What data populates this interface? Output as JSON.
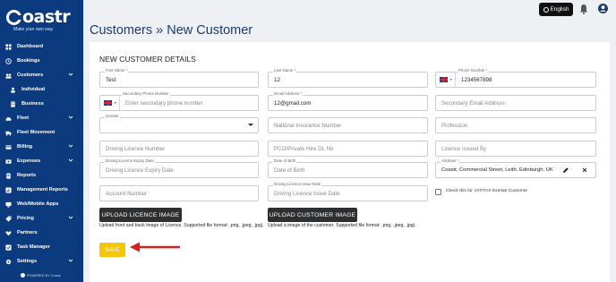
{
  "brand": {
    "name": "Coastr",
    "tagline": "Make your own way"
  },
  "sidebar": {
    "items": [
      {
        "label": "Dashboard",
        "icon": "dashboard-icon"
      },
      {
        "label": "Bookings",
        "icon": "bookings-icon"
      },
      {
        "label": "Customers",
        "icon": "users-icon",
        "expandable": true
      },
      {
        "label": "Individual",
        "icon": "person-icon",
        "sub": true
      },
      {
        "label": "Business",
        "icon": "building-icon",
        "sub": true
      },
      {
        "label": "Fleet",
        "icon": "car-icon",
        "expandable": true
      },
      {
        "label": "Fleet Movement",
        "icon": "fleet-movement-icon"
      },
      {
        "label": "Billing",
        "icon": "billing-icon",
        "expandable": true
      },
      {
        "label": "Expenses",
        "icon": "expenses-icon",
        "expandable": true
      },
      {
        "label": "Reports",
        "icon": "reports-icon"
      },
      {
        "label": "Management Reports",
        "icon": "management-reports-icon"
      },
      {
        "label": "Web/Mobile Apps",
        "icon": "apps-icon"
      },
      {
        "label": "Pricing",
        "icon": "pricing-icon",
        "expandable": true
      },
      {
        "label": "Partners",
        "icon": "partners-icon"
      },
      {
        "label": "Task Manager",
        "icon": "task-icon"
      },
      {
        "label": "Settings",
        "icon": "gear-icon",
        "expandable": true
      }
    ],
    "powered_by": "POWERED BY Coastr"
  },
  "header": {
    "language": "English"
  },
  "page": {
    "breadcrumb_parent": "Customers",
    "separator": "»",
    "title": "New Customer"
  },
  "form": {
    "section_title": "NEW CUSTOMER DETAILS",
    "first_name": {
      "label": "First Name *",
      "value": "Test"
    },
    "last_name": {
      "label": "Last Name *",
      "value": "12"
    },
    "phone": {
      "label": "Phone Number *",
      "value": "1234567898"
    },
    "secondary_phone": {
      "label": "Secondary Phone Number",
      "placeholder": "Enter secondary phone number"
    },
    "email": {
      "label": "Email Address *",
      "value": "12@gmail.com"
    },
    "secondary_email": {
      "placeholder": "Secondary Email Address"
    },
    "gender": {
      "label": "Gender"
    },
    "national_insurance": {
      "placeholder": "National Insurance Number"
    },
    "profession": {
      "placeholder": "Profession"
    },
    "driving_licence_number": {
      "placeholder": "Driving Licence Number"
    },
    "pco_number": {
      "placeholder": "PCO/Private Hire DL No"
    },
    "licence_issued_by": {
      "placeholder": "Licence Issued By"
    },
    "licence_expiry": {
      "label": "Driving Licence Expiry Date",
      "placeholder": "Driving Licence Expiry Date"
    },
    "dob": {
      "label": "Date of Birth",
      "placeholder": "Date of Birth"
    },
    "address": {
      "label": "Address *",
      "value": "Coastr, Commercial Street, Leith, Edinburgh, UK"
    },
    "account_number": {
      "placeholder": "Account Number"
    },
    "licence_issue_date": {
      "label": "Driving Licence Issue Date",
      "placeholder": "Driving Licence Issue Date"
    },
    "vat_exempt_label": "Check this for VAT/TAX Exempt Customer",
    "upload_licence_button": "UPLOAD LICENCE IMAGE",
    "upload_licence_help": "Upload front and back image of Licence. Supported file format: .png, .jpeg, .jpg).",
    "upload_customer_button": "UPLOAD CUSTOMER IMAGE",
    "upload_customer_help": "Upload a image of the customer. Supported file format: .png, .jpeg, .jpg).",
    "save_button": "SAVE"
  },
  "colors": {
    "sidebar": "#0b3a7e",
    "title": "#1d3c6e",
    "save": "#f7c600",
    "annotation_arrow": "#d42020"
  }
}
